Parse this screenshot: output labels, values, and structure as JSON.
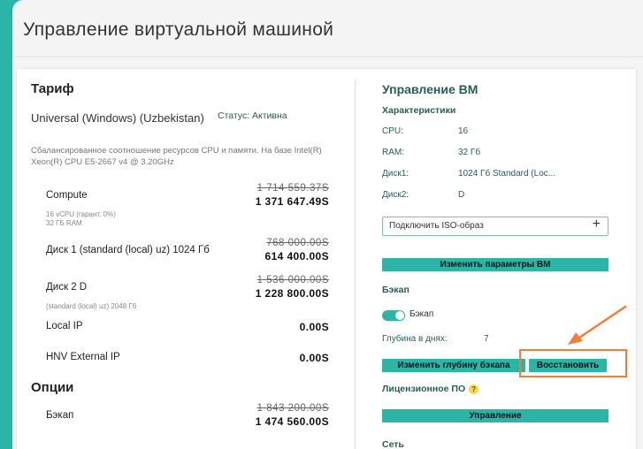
{
  "page": {
    "title": "Управление виртуальной машиной"
  },
  "tariff": {
    "heading": "Тариф",
    "plan_name": "Universal (Windows) (Uzbekistan)",
    "status": "Статус: Активна",
    "description": "Сбалансированное соотношение ресурсов CPU и памяти. На базе Intel(R) Xeon(R) CPU E5-2667 v4 @ 3.20GHz",
    "items": [
      {
        "name": "Compute",
        "sub1": "16 vCPU (гарант. 0%)",
        "sub2": "32 ГБ RAM",
        "old_price": "1 714 559.37S",
        "new_price": "1 371 647.49S"
      },
      {
        "name": "Диск 1 (standard (local) uz) 1024 Гб",
        "old_price": "768 000.00S",
        "new_price": "614 400.00S"
      },
      {
        "name": "Диск 2 D",
        "sub1": "(standard (local) uz) 2048 Гб",
        "old_price": "1 536 000.00S",
        "new_price": "1 228 800.00S"
      },
      {
        "name": "Local IP",
        "price": "0.00S"
      },
      {
        "name": "HNV External IP",
        "price": "0.00S"
      }
    ]
  },
  "options": {
    "heading": "Опции",
    "items": [
      {
        "name": "Бэкап",
        "old_price": "1 843 200.00S",
        "new_price": "1 474 560.00S"
      }
    ]
  },
  "vm": {
    "heading": "Управление ВМ",
    "specs_heading": "Характеристики",
    "specs": [
      {
        "label": "CPU:",
        "value": "16"
      },
      {
        "label": "RAM:",
        "value": "32 Гб"
      },
      {
        "label": "Диск1:",
        "value": "1024 Гб Standard (Loc..."
      },
      {
        "label": "Диск2:",
        "value": "D"
      }
    ],
    "iso_button": "Подключить ISO-образ",
    "iso_plus": "+",
    "change_params_button": "Изменить параметры ВМ",
    "backup_heading": "Бэкап",
    "backup_toggle_label": "Бэкап",
    "backup_toggle_on": true,
    "depth_label": "Глубина в днях:",
    "depth_value": "7",
    "change_depth_button": "Изменить глубину бэкапа",
    "restore_button": "Восстановить",
    "license_heading": "Лицензионное ПО",
    "license_help": "?",
    "manage_button": "Управление",
    "network_heading": "Сеть"
  },
  "colors": {
    "accent": "#2bb5a7",
    "highlight": "#f07f3c",
    "heading_green": "#2a5d55"
  }
}
